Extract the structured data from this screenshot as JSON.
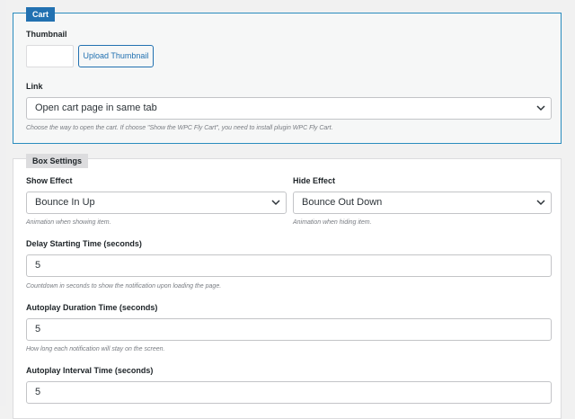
{
  "cart": {
    "legend": "Cart",
    "thumbnail_label": "Thumbnail",
    "upload_button": "Upload Thumbnail",
    "link_label": "Link",
    "link_value": "Open cart page in same tab",
    "link_help": "Choose the way to open the cart. If choose \"Show the WPC Fly Cart\", you need to install plugin WPC Fly Cart."
  },
  "box_settings": {
    "legend": "Box Settings",
    "show_effect_label": "Show Effect",
    "show_effect_value": "Bounce In Up",
    "show_effect_help": "Animation when showing item.",
    "hide_effect_label": "Hide Effect",
    "hide_effect_value": "Bounce Out Down",
    "hide_effect_help": "Animation when hiding item.",
    "delay_label": "Delay Starting Time (seconds)",
    "delay_value": "5",
    "delay_help": "Countdown in seconds to show the notification upon loading the page.",
    "duration_label": "Autoplay Duration Time (seconds)",
    "duration_value": "5",
    "duration_help": "How long each notification will stay on the screen.",
    "interval_label": "Autoplay Interval Time (seconds)",
    "interval_value": "5"
  },
  "icons": {
    "dropdown": "chevron-down-icon"
  },
  "colors": {
    "accent": "#2271b1",
    "cart_border": "#2a8cbe",
    "help_text": "#787c82"
  }
}
